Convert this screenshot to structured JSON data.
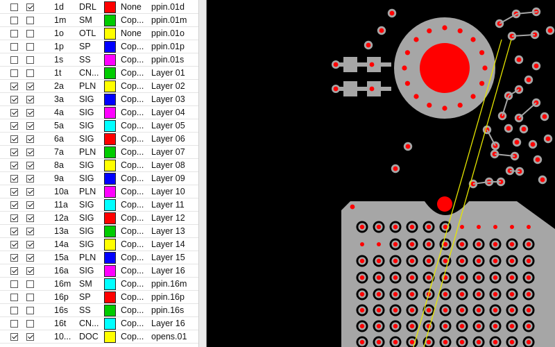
{
  "layers": [
    {
      "name": "1d",
      "type": "DRL",
      "color": "#ff0000",
      "material": "None",
      "file": "ppin.01d",
      "visible": false,
      "selectable": true
    },
    {
      "name": "1m",
      "type": "SM",
      "color": "#00cc00",
      "material": "Cop...",
      "file": "ppin.01m",
      "visible": false,
      "selectable": false
    },
    {
      "name": "1o",
      "type": "OTL",
      "color": "#ffff00",
      "material": "None",
      "file": "ppin.01o",
      "visible": false,
      "selectable": false
    },
    {
      "name": "1p",
      "type": "SP",
      "color": "#0000ff",
      "material": "Cop...",
      "file": "ppin.01p",
      "visible": false,
      "selectable": false
    },
    {
      "name": "1s",
      "type": "SS",
      "color": "#ff00ff",
      "material": "Cop...",
      "file": "ppin.01s",
      "visible": false,
      "selectable": false
    },
    {
      "name": "1t",
      "type": "CN...",
      "color": "#00cc00",
      "material": "Cop...",
      "file": "Layer 01",
      "visible": false,
      "selectable": false
    },
    {
      "name": "2a",
      "type": "PLN",
      "color": "#ffff00",
      "material": "Cop...",
      "file": "Layer 02",
      "visible": true,
      "selectable": true
    },
    {
      "name": "3a",
      "type": "SIG",
      "color": "#0000ff",
      "material": "Cop...",
      "file": "Layer 03",
      "visible": true,
      "selectable": true
    },
    {
      "name": "4a",
      "type": "SIG",
      "color": "#ff00ff",
      "material": "Cop...",
      "file": "Layer 04",
      "visible": true,
      "selectable": true
    },
    {
      "name": "5a",
      "type": "SIG",
      "color": "#00ffff",
      "material": "Cop...",
      "file": "Layer 05",
      "visible": true,
      "selectable": true
    },
    {
      "name": "6a",
      "type": "SIG",
      "color": "#ff0000",
      "material": "Cop...",
      "file": "Layer 06",
      "visible": true,
      "selectable": true
    },
    {
      "name": "7a",
      "type": "PLN",
      "color": "#00cc00",
      "material": "Cop...",
      "file": "Layer 07",
      "visible": true,
      "selectable": true
    },
    {
      "name": "8a",
      "type": "SIG",
      "color": "#ffff00",
      "material": "Cop...",
      "file": "Layer 08",
      "visible": true,
      "selectable": true
    },
    {
      "name": "9a",
      "type": "SIG",
      "color": "#0000ff",
      "material": "Cop...",
      "file": "Layer 09",
      "visible": true,
      "selectable": true
    },
    {
      "name": "10a",
      "type": "PLN",
      "color": "#ff00ff",
      "material": "Cop...",
      "file": "Layer 10",
      "visible": true,
      "selectable": true
    },
    {
      "name": "11a",
      "type": "SIG",
      "color": "#00ffff",
      "material": "Cop...",
      "file": "Layer 11",
      "visible": true,
      "selectable": true
    },
    {
      "name": "12a",
      "type": "SIG",
      "color": "#ff0000",
      "material": "Cop...",
      "file": "Layer 12",
      "visible": true,
      "selectable": true
    },
    {
      "name": "13a",
      "type": "SIG",
      "color": "#00cc00",
      "material": "Cop...",
      "file": "Layer 13",
      "visible": true,
      "selectable": true
    },
    {
      "name": "14a",
      "type": "SIG",
      "color": "#ffff00",
      "material": "Cop...",
      "file": "Layer 14",
      "visible": true,
      "selectable": true
    },
    {
      "name": "15a",
      "type": "PLN",
      "color": "#0000ff",
      "material": "Cop...",
      "file": "Layer 15",
      "visible": true,
      "selectable": true
    },
    {
      "name": "16a",
      "type": "SIG",
      "color": "#ff00ff",
      "material": "Cop...",
      "file": "Layer 16",
      "visible": true,
      "selectable": true
    },
    {
      "name": "16m",
      "type": "SM",
      "color": "#00ffff",
      "material": "Cop...",
      "file": "ppin.16m",
      "visible": false,
      "selectable": false
    },
    {
      "name": "16p",
      "type": "SP",
      "color": "#ff0000",
      "material": "Cop...",
      "file": "ppin.16p",
      "visible": false,
      "selectable": false
    },
    {
      "name": "16s",
      "type": "SS",
      "color": "#00cc00",
      "material": "Cop...",
      "file": "ppin.16s",
      "visible": false,
      "selectable": false
    },
    {
      "name": "16t",
      "type": "CN...",
      "color": "#00ffff",
      "material": "Cop...",
      "file": "Layer 16",
      "visible": false,
      "selectable": false
    },
    {
      "name": "10...",
      "type": "DOC",
      "color": "#ffff00",
      "material": "Cop...",
      "file": "opens.01",
      "visible": true,
      "selectable": true
    }
  ],
  "board_colors": {
    "background": "#000000",
    "copper": "#a6a6a6",
    "drill": "#ff0000",
    "antipad": "#000000",
    "route": "#e6e600"
  }
}
